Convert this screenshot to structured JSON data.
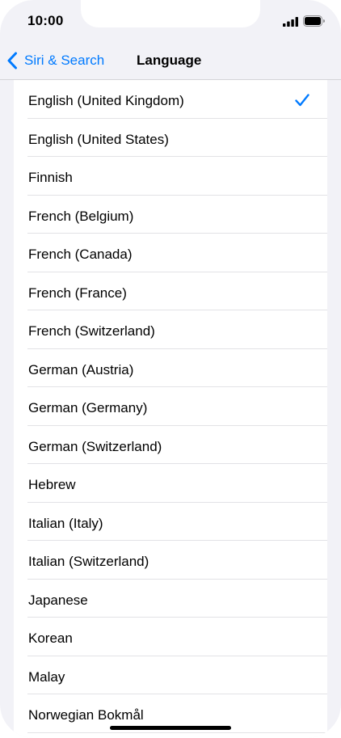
{
  "status_bar": {
    "time": "10:00",
    "signal_icon": "cellular-signal-icon",
    "battery_icon": "battery-icon"
  },
  "nav": {
    "back_label": "Siri & Search",
    "back_icon": "chevron-left-icon",
    "title": "Language"
  },
  "languages": {
    "selected": "English (United Kingdom)",
    "items": [
      {
        "label": "English (United Kingdom)",
        "checked": true
      },
      {
        "label": "English (United States)",
        "checked": false
      },
      {
        "label": "Finnish",
        "checked": false
      },
      {
        "label": "French (Belgium)",
        "checked": false
      },
      {
        "label": "French (Canada)",
        "checked": false
      },
      {
        "label": "French (France)",
        "checked": false
      },
      {
        "label": "French (Switzerland)",
        "checked": false
      },
      {
        "label": "German (Austria)",
        "checked": false
      },
      {
        "label": "German (Germany)",
        "checked": false
      },
      {
        "label": "German (Switzerland)",
        "checked": false
      },
      {
        "label": "Hebrew",
        "checked": false
      },
      {
        "label": "Italian (Italy)",
        "checked": false
      },
      {
        "label": "Italian (Switzerland)",
        "checked": false
      },
      {
        "label": "Japanese",
        "checked": false
      },
      {
        "label": "Korean",
        "checked": false
      },
      {
        "label": "Malay",
        "checked": false
      },
      {
        "label": "Norwegian Bokmål",
        "checked": false
      }
    ]
  },
  "colors": {
    "accent": "#007aff",
    "background": "#f2f2f7",
    "cell": "#ffffff"
  }
}
